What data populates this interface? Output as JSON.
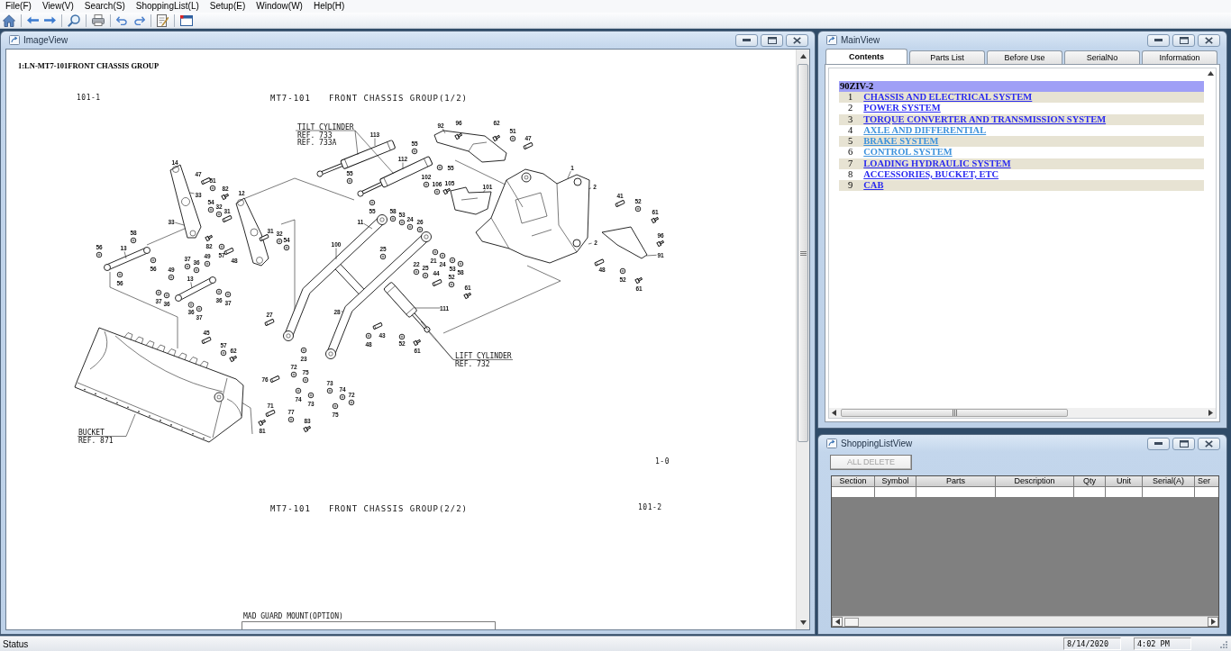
{
  "menu": [
    {
      "label": "File(F)"
    },
    {
      "label": "View(V)"
    },
    {
      "label": "Search(S)"
    },
    {
      "label": "ShoppingList(L)"
    },
    {
      "label": "Setup(E)"
    },
    {
      "label": "Window(W)"
    },
    {
      "label": "Help(H)"
    }
  ],
  "image_view": {
    "title": "ImageView",
    "heading": "1:LN-MT7-101FRONT CHASSIS GROUP",
    "drawing": {
      "sheet_top": "101-1",
      "title_top": {
        "code": "MT7-101",
        "name": "FRONT CHASSIS GROUP(1/2)"
      },
      "notes": [
        {
          "lines": [
            "TILT CYLINDER",
            "REF. 733",
            "REF. 733A"
          ]
        },
        {
          "lines": [
            "LIFT CYLINDER",
            "REF. 732"
          ]
        },
        {
          "lines": [
            "BUCKET",
            "REF. 871"
          ]
        }
      ],
      "callouts": [
        "92",
        "96",
        "62",
        "51",
        "113",
        "47",
        "55",
        "14",
        "112",
        "55",
        "1",
        "47",
        "55",
        "102",
        "51",
        "106",
        "105",
        "82",
        "101",
        "2",
        "33",
        "12",
        "41",
        "54",
        "52",
        "32",
        "31",
        "55",
        "58",
        "53",
        "61",
        "33",
        "11",
        "24",
        "26",
        "58",
        "31",
        "32",
        "96",
        "54",
        "100",
        "2",
        "56",
        "13",
        "82",
        "25",
        "49",
        "57",
        "91",
        "37",
        "36",
        "48",
        "21",
        "22",
        "24",
        "56",
        "49",
        "25",
        "53",
        "48",
        "44",
        "58",
        "13",
        "52",
        "52",
        "56",
        "61",
        "61",
        "37",
        "36",
        "36",
        "37",
        "111",
        "36",
        "28",
        "27",
        "37",
        "45",
        "43",
        "57",
        "48",
        "52",
        "62",
        "61",
        "23",
        "72",
        "75",
        "76",
        "73",
        "74",
        "72",
        "74",
        "71",
        "73",
        "77",
        "75",
        "83",
        "81"
      ],
      "page_mark": "1-0",
      "title_bottom": {
        "code": "MT7-101",
        "name": "FRONT CHASSIS GROUP(2/2)"
      },
      "sheet_bottom": "101-2",
      "option_label": "MAD GUARD MOUNT(OPTION)"
    }
  },
  "main_view": {
    "title": "MainView",
    "tabs": [
      {
        "label": "Contents",
        "selected": true
      },
      {
        "label": "Parts List",
        "selected": false
      },
      {
        "label": "Before Use",
        "selected": false
      },
      {
        "label": "SerialNo",
        "selected": false
      },
      {
        "label": "Information",
        "selected": false
      }
    ],
    "contents": {
      "model": "90ZIV-2",
      "sections": [
        {
          "number": "1",
          "title": "CHASSIS AND ELECTRICAL SYSTEM",
          "visited": false
        },
        {
          "number": "2",
          "title": "POWER SYSTEM",
          "visited": false
        },
        {
          "number": "3",
          "title": "TORQUE CONVERTER AND TRANSMISSION SYSTEM",
          "visited": false
        },
        {
          "number": "4",
          "title": "AXLE AND DIFFERENTIAL",
          "visited": true
        },
        {
          "number": "5",
          "title": "BRAKE SYSTEM",
          "visited": true
        },
        {
          "number": "6",
          "title": "CONTROL SYSTEM",
          "visited": true
        },
        {
          "number": "7",
          "title": "LOADING HYDRAULIC SYSTEM",
          "visited": false
        },
        {
          "number": "8",
          "title": "ACCESSORIES, BUCKET, ETC",
          "visited": false
        },
        {
          "number": "9",
          "title": "CAB",
          "visited": false
        }
      ]
    }
  },
  "shopping_list_view": {
    "title": "ShoppingListView",
    "delete_button": {
      "label": "ALL DELETE",
      "disabled": true
    },
    "columns": [
      "Section",
      "Symbol",
      "Parts",
      "Description",
      "Qty",
      "Unit",
      "Serial(A)",
      "Ser"
    ]
  },
  "status_bar": {
    "text": "Status",
    "date": "8/14/2020",
    "time": "4:02 PM"
  }
}
